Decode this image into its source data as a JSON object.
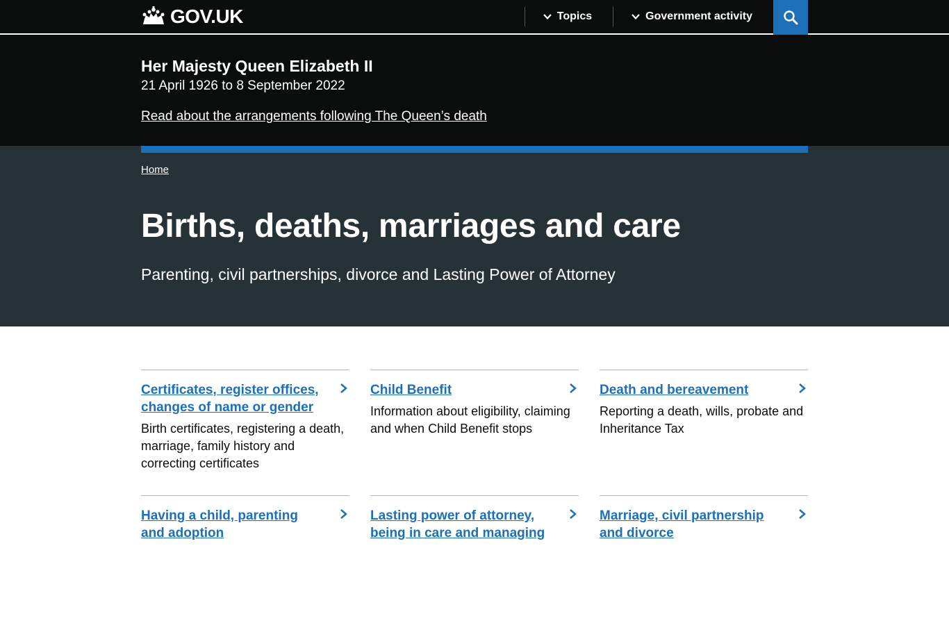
{
  "header": {
    "logo_text": "GOV.UK",
    "nav": [
      {
        "label": "Topics"
      },
      {
        "label": "Government activity"
      }
    ],
    "search_icon": "search-icon"
  },
  "notice": {
    "title": "Her Majesty Queen Elizabeth II",
    "dates": "21 April 1926 to 8 September 2022",
    "link": "Read about the arrangements following The Queen’s death"
  },
  "hero": {
    "breadcrumb": "Home",
    "title": "Births, deaths, marriages and care",
    "subtitle": "Parenting, civil partnerships, divorce and Lasting Power of Attorney"
  },
  "topics": [
    {
      "title": "Certificates, register offices, changes of name or gender",
      "description": "Birth certificates, registering a death, marriage, family history and correcting certificates"
    },
    {
      "title": "Child Benefit",
      "description": "Information about eligibility, claiming and when Child Benefit stops"
    },
    {
      "title": "Death and bereavement",
      "description": "Reporting a death, wills, probate and Inheritance Tax"
    },
    {
      "title": "Having a child, parenting and adoption",
      "description": ""
    },
    {
      "title": "Lasting power of attorney, being in care and managing",
      "description": ""
    },
    {
      "title": "Marriage, civil partnership and divorce",
      "description": ""
    }
  ],
  "colors": {
    "header_bg": "#0b0c0c",
    "hero_bg": "#263238",
    "accent": "#1d70b8"
  }
}
